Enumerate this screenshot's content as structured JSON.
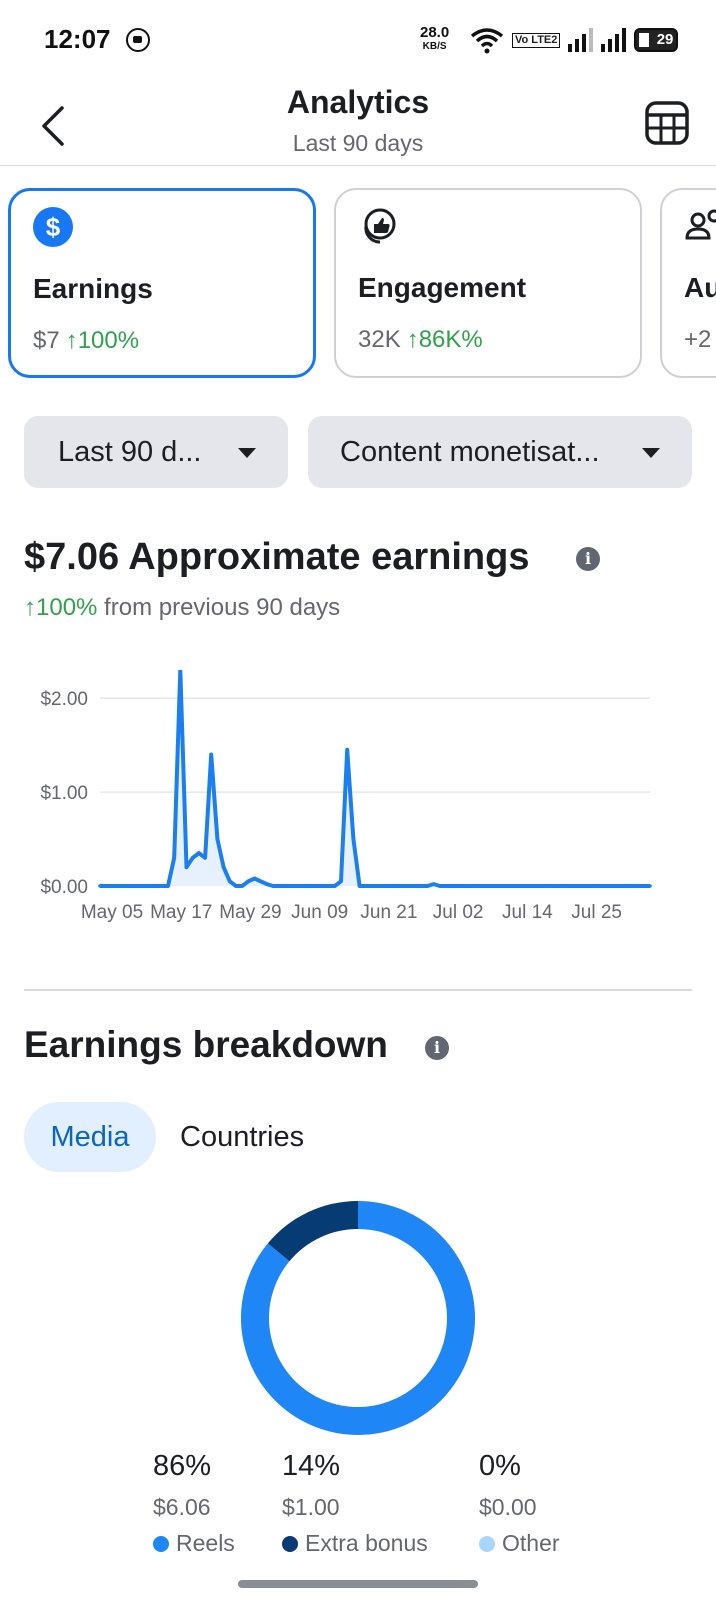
{
  "status_bar": {
    "time": "12:07",
    "net_speed": "28.0",
    "net_speed_unit": "KB/S",
    "volte_label": "Vo LTE2",
    "battery": "29"
  },
  "header": {
    "title": "Analytics",
    "subtitle": "Last 90 days",
    "back_icon": "back-arrow-icon",
    "table_icon": "table-icon"
  },
  "cards": [
    {
      "title": "Earnings",
      "value": "$7",
      "change": "↑100%",
      "icon": "dollar-icon",
      "selected": true
    },
    {
      "title": "Engagement",
      "value": "32K",
      "change": "↑86K%",
      "icon": "thumbs-up-icon",
      "selected": false
    },
    {
      "title": "Au",
      "value": "+2",
      "change": "",
      "icon": "people-icon",
      "selected": false
    }
  ],
  "filters": {
    "date_range": "Last 90 d...",
    "content_type": "Content monetisat..."
  },
  "earnings": {
    "amount_title": "$7.06 Approximate earnings",
    "change_pct": "↑100%",
    "change_text": " from previous 90 days"
  },
  "chart_data": {
    "type": "area",
    "x": [
      "May 02",
      "May 03",
      "May 04",
      "May 05",
      "May 06",
      "May 07",
      "May 08",
      "May 09",
      "May 10",
      "May 11",
      "May 12",
      "May 13",
      "May 14",
      "May 15",
      "May 16",
      "May 17",
      "May 18",
      "May 19",
      "May 20",
      "May 21",
      "May 22",
      "May 23",
      "May 24",
      "May 25",
      "May 26",
      "May 27",
      "May 28",
      "May 29",
      "May 30",
      "May 31",
      "Jun 01",
      "Jun 02",
      "Jun 03",
      "Jun 04",
      "Jun 05",
      "Jun 06",
      "Jun 07",
      "Jun 08",
      "Jun 09",
      "Jun 10",
      "Jun 11",
      "Jun 12",
      "Jun 13",
      "Jun 14",
      "Jun 15",
      "Jun 16",
      "Jun 17",
      "Jun 18",
      "Jun 19",
      "Jun 20",
      "Jun 21",
      "Jun 22",
      "Jun 23",
      "Jun 24",
      "Jun 25",
      "Jun 26",
      "Jun 27",
      "Jun 28",
      "Jun 29",
      "Jun 30",
      "Jul 01",
      "Jul 02",
      "Jul 03",
      "Jul 04",
      "Jul 05",
      "Jul 06",
      "Jul 07",
      "Jul 08",
      "Jul 09",
      "Jul 10",
      "Jul 11",
      "Jul 12",
      "Jul 13",
      "Jul 14",
      "Jul 15",
      "Jul 16",
      "Jul 17",
      "Jul 18",
      "Jul 19",
      "Jul 20",
      "Jul 21",
      "Jul 22",
      "Jul 23",
      "Jul 24",
      "Jul 25",
      "Jul 26",
      "Jul 27",
      "Jul 28",
      "Jul 29",
      "Jul 30"
    ],
    "values": [
      0,
      0,
      0,
      0,
      0,
      0,
      0,
      0,
      0,
      0,
      0,
      0,
      0.3,
      2.3,
      0.2,
      0.3,
      0.35,
      0.3,
      1.4,
      0.5,
      0.2,
      0.05,
      0,
      0,
      0.05,
      0.08,
      0.05,
      0.02,
      0,
      0,
      0,
      0,
      0,
      0,
      0,
      0,
      0,
      0,
      0,
      0.05,
      1.45,
      0.5,
      0,
      0,
      0,
      0,
      0,
      0,
      0,
      0,
      0,
      0,
      0,
      0,
      0.02,
      0,
      0,
      0,
      0,
      0,
      0,
      0,
      0,
      0,
      0,
      0,
      0,
      0,
      0,
      0,
      0,
      0,
      0,
      0,
      0,
      0,
      0,
      0,
      0,
      0,
      0,
      0,
      0,
      0,
      0,
      0,
      0,
      0,
      0,
      0
    ],
    "x_tick_labels": [
      "May 05",
      "May 17",
      "May 29",
      "Jun 09",
      "Jun 21",
      "Jul 02",
      "Jul 14",
      "Jul 25"
    ],
    "y_tick_labels": [
      "$0.00",
      "$1.00",
      "$2.00"
    ],
    "y_ticks": [
      0,
      1,
      2
    ],
    "ylim": [
      0,
      2.3
    ],
    "grid": true,
    "color": "#1b7ff0"
  },
  "breakdown": {
    "title": "Earnings breakdown",
    "tabs": [
      "Media",
      "Countries"
    ],
    "active_tab": "Media",
    "donut": [
      {
        "label": "Reels",
        "fraction": 0.86,
        "color": "#1f87f5"
      },
      {
        "label": "Extra bonus",
        "fraction": 0.14,
        "color": "#073b74"
      },
      {
        "label": "Other",
        "fraction": 0.0,
        "color": "#a8d6fb"
      }
    ],
    "legend": [
      {
        "pct": "86%",
        "amount": "$6.06",
        "label": "Reels",
        "color": "#1f87f5"
      },
      {
        "pct": "14%",
        "amount": "$1.00",
        "label": "Extra bonus",
        "color": "#073b74"
      },
      {
        "pct": "0%",
        "amount": "$0.00",
        "label": "Other",
        "color": "#a8d6fb"
      }
    ]
  }
}
